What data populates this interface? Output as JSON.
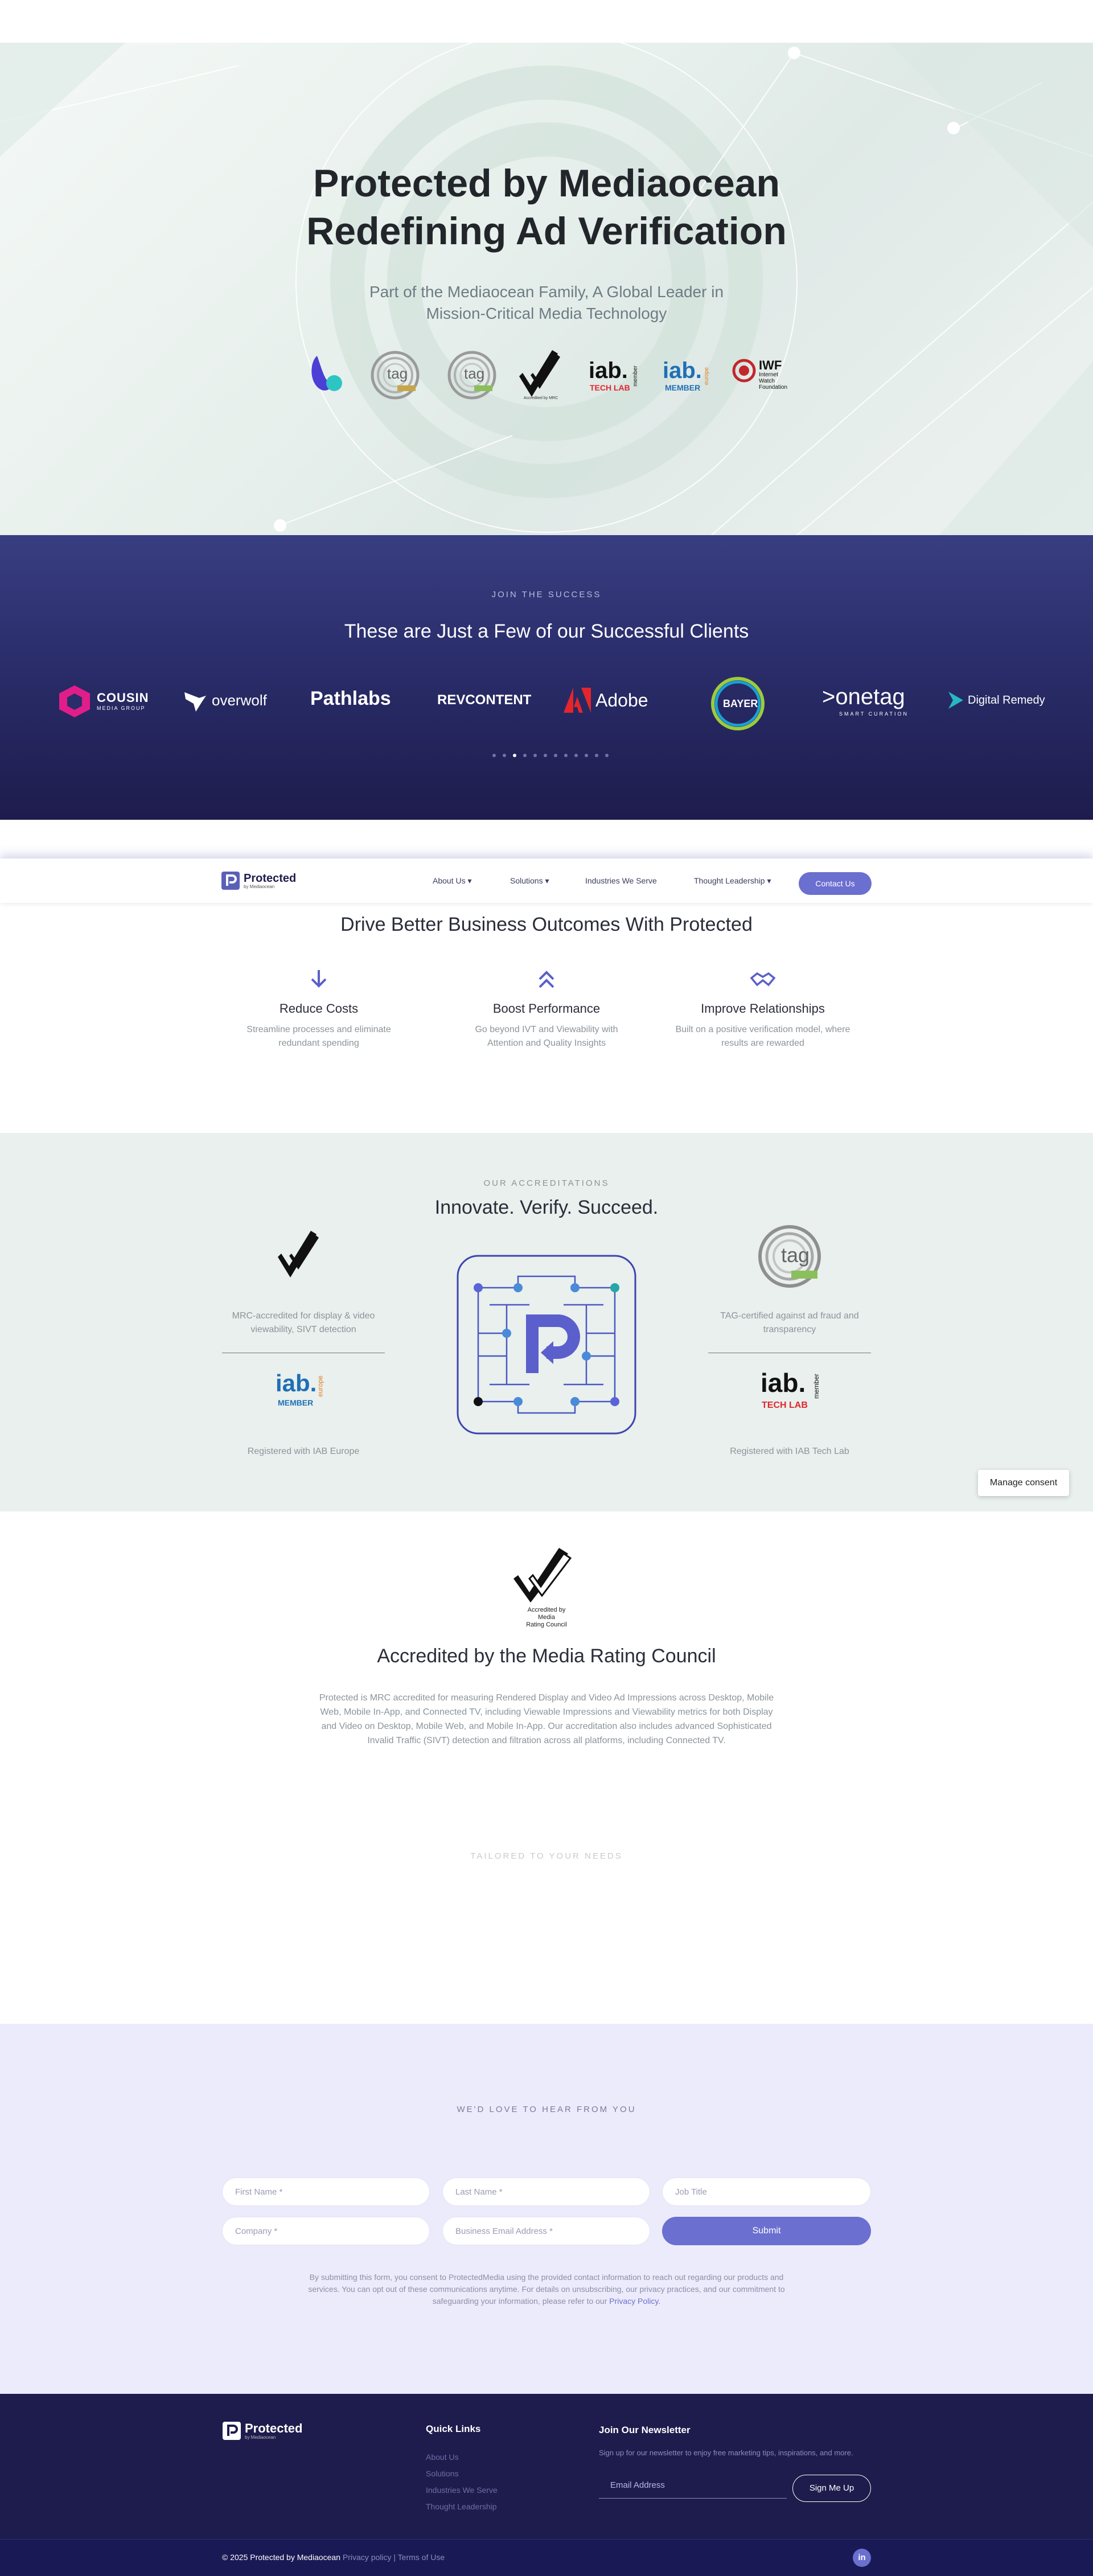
{
  "hero": {
    "title_line1": "Protected by Mediaocean",
    "title_line2": "Redefining Ad Verification",
    "subtitle_line1": "Part of the Mediaocean Family, A Global Leader in",
    "subtitle_line2": "Mission-Critical Media Technology",
    "badges": {
      "tag1": "tag",
      "tag2": "tag",
      "mrc": "Accredited by Media Rating Council",
      "iab_word": "iab.",
      "iab_sub": "TECH LAB",
      "iab_member_vert": "member",
      "iab_eu_word": "iab.",
      "iab_eu_sub": "MEMBER",
      "iab_eu_vert": "europe",
      "iwf_word": "IWF",
      "iwf_line1": "Internet",
      "iwf_line2": "Watch",
      "iwf_line3": "Foundation"
    }
  },
  "clients": {
    "eyebrow": "JOIN THE SUCCESS",
    "title": "These are Just a Few of our Successful Clients",
    "logos": {
      "cousin_main": "COUSIN",
      "cousin_sub": "MEDIA GROUP",
      "overwolf": "overwolf",
      "pathlabs": "Pathlabs",
      "revcontent": "REVCONTENT",
      "adobe": "Adobe",
      "bayer": "BAYER",
      "onetag": ">onetag",
      "onetag_sub": "SMART CURATION",
      "digital_remedy": "Digital Remedy"
    },
    "dot_count": 12,
    "active_dot": 3
  },
  "nav": {
    "brand": "Protected",
    "brand_sub": "by Mediaocean",
    "items": [
      "About Us",
      "Solutions",
      "Industries We Serve",
      "Thought Leadership"
    ],
    "cta": "Contact Us"
  },
  "outcomes": {
    "title": "Drive Better Business Outcomes With Protected",
    "features": [
      {
        "title": "Reduce Costs",
        "line1": "Streamline processes and eliminate",
        "line2": "redundant spending",
        "icon": "arrow-down-icon"
      },
      {
        "title": "Boost Performance",
        "line1": "Go beyond IVT and Viewability with",
        "line2": "Attention and Quality Insights",
        "icon": "double-chevron-up-icon"
      },
      {
        "title": "Improve Relationships",
        "line1": "Built on a positive verification model, where",
        "line2": "results are rewarded",
        "icon": "handshake-icon"
      }
    ]
  },
  "accreditations": {
    "eyebrow": "OUR ACCREDITATIONS",
    "title": "Innovate. Verify. Succeed.",
    "mrc_caption_1": "MRC-accredited for display & video",
    "mrc_caption_2": "viewability, SIVT detection",
    "tag_caption_1": "TAG-certified against ad fraud and",
    "tag_caption_2": "transparency",
    "iab_eu_caption": "Registered with IAB Europe",
    "iab_tl_caption": "Registered with IAB Tech Lab",
    "mrc_logo_text": "Accredited by Media Rating Council",
    "tag_word": "tag",
    "iab_eu_word": "iab.",
    "iab_eu_sub": "MEMBER",
    "iab_eu_vert": "europe",
    "iab_tl_word": "iab.",
    "iab_tl_sub": "TECH LAB",
    "iab_tl_vert": "member"
  },
  "manage_consent": "Manage consent",
  "mrc": {
    "logo_line1": "Accredited by",
    "logo_line2": "Media",
    "logo_line3": "Rating Council",
    "title": "Accredited by the Media Rating Council",
    "line1": "Protected is MRC accredited for measuring Rendered Display and Video Ad Impressions across Desktop, Mobile",
    "line2": "Web, Mobile In-App, and Connected TV, including Viewable Impressions and Viewability metrics for both Display",
    "line3": "and Video on Desktop, Mobile Web, and Mobile In-App. Our accreditation also includes advanced Sophisticated",
    "line4": "Invalid Traffic (SIVT) detection and filtration across all platforms, including Connected TV."
  },
  "tailored": "TAILORED TO YOUR NEEDS",
  "contact": {
    "eyebrow": "WE'D LOVE TO HEAR FROM YOU",
    "fields": {
      "first_name": "First Name *",
      "last_name": "Last Name *",
      "job_title": "Job Title",
      "company": "Company *",
      "email": "Business Email Address *"
    },
    "submit": "Submit",
    "consent_1": "By submitting this form, you consent to ProtectedMedia using the provided contact information to reach out regarding our products and",
    "consent_2": "services. You can opt out of these communications anytime. For details on unsubscribing, our privacy practices, and our commitment to",
    "consent_3": "safeguarding your information, please refer to our",
    "consent_link": "Privacy Policy.",
    "consent_end": ""
  },
  "footer": {
    "brand": "Protected",
    "brand_sub": "by Mediaocean",
    "quick_links_title": "Quick Links",
    "links": [
      "About Us",
      "Solutions",
      "Industries We Serve",
      "Thought Leadership"
    ],
    "newsletter_title": "Join Our Newsletter",
    "newsletter_text": "Sign up for our newsletter to enjoy free marketing tips, inspirations, and more.",
    "email_placeholder": "Email Address",
    "signup": "Sign Me Up",
    "copyright": "© 2025 Protected by Mediaocean",
    "privacy": "Privacy policy",
    "separator": "|",
    "terms": "Terms of Use",
    "social": "in"
  },
  "colors": {
    "accent": "#6b6fd0",
    "navy": "#1e1c4d",
    "heading": "#22252a",
    "muted": "#8b949a"
  }
}
